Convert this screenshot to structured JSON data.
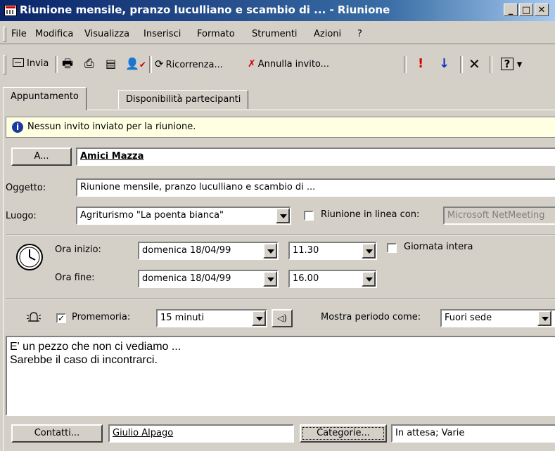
{
  "window": {
    "title": "Riunione mensile, pranzo luculliano e scambio di ... - Riunione"
  },
  "menu": [
    "File",
    "Modifica",
    "Visualizza",
    "Inserisci",
    "Formato",
    "Strumenti",
    "Azioni",
    "?"
  ],
  "toolbar": {
    "send_label": "Invia",
    "recurrence_label": "Ricorrenza...",
    "cancel_invite_label": "Annulla invito..."
  },
  "tabs": [
    "Appuntamento",
    "Disponibilità partecipanti"
  ],
  "info_bar": {
    "text": "Nessun invito inviato per la riunione."
  },
  "to": {
    "button": "A...",
    "value": "Amici Mazza"
  },
  "subject": {
    "label": "Oggetto:",
    "value": "Riunione mensile, pranzo luculliano e scambio di ..."
  },
  "location": {
    "label": "Luogo:",
    "value": "Agriturismo \"La poenta bianca\"",
    "online_label": "Riunione in linea con:",
    "online_value": "Microsoft NetMeeting"
  },
  "start": {
    "label": "Ora inizio:",
    "date": "domenica 18/04/99",
    "time": "11.30",
    "allday_label": "Giornata intera"
  },
  "end": {
    "label": "Ora fine:",
    "date": "domenica 18/04/99",
    "time": "16.00"
  },
  "reminder": {
    "label": "Promemoria:",
    "value": "15 minuti",
    "show_as_label": "Mostra periodo come:",
    "show_as_value": "Fuori sede"
  },
  "notes": [
    "E' un pezzo che non ci vediamo ...",
    "Sarebbe il caso di incontrarci."
  ],
  "footer": {
    "contacts_button": "Contatti...",
    "contacts_value": "Giulio Alpago",
    "categories_button": "Categorie...",
    "categories_value": "In attesa; Varie"
  }
}
